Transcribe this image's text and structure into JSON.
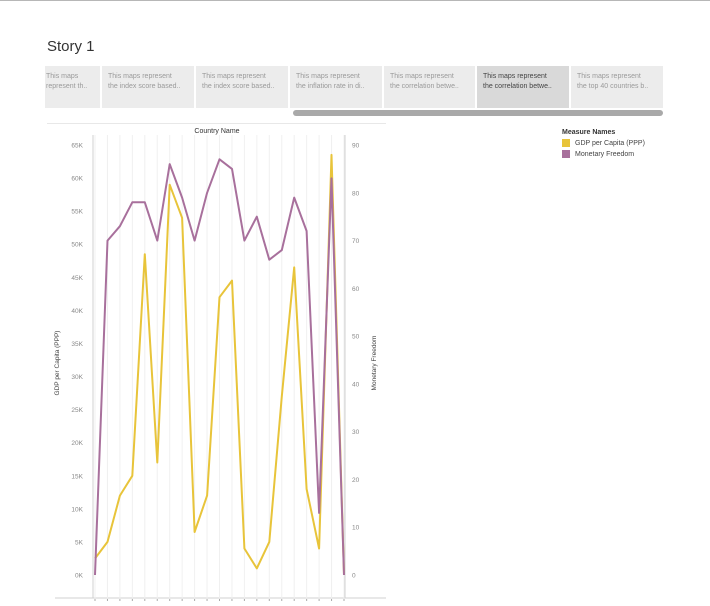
{
  "story": {
    "title": "Story 1"
  },
  "tabs": [
    {
      "line1": "This maps",
      "line2": "represent th..",
      "active": false
    },
    {
      "line1": "This maps represent",
      "line2": "the index score based..",
      "active": false
    },
    {
      "line1": "This maps represent",
      "line2": "the index score based..",
      "active": false
    },
    {
      "line1": "This maps represent",
      "line2": "the inflation rate in di..",
      "active": false
    },
    {
      "line1": "This maps represent",
      "line2": "the correlation betwe..",
      "active": false
    },
    {
      "line1": "This maps represent",
      "line2": "the correlation betwe..",
      "active": true
    },
    {
      "line1": "This maps represent",
      "line2": "the top 40 countries b..",
      "active": false
    }
  ],
  "legend": {
    "title": "Measure Names",
    "items": [
      {
        "label": "GDP per Capita (PPP)",
        "color": "#e8c43a"
      },
      {
        "label": "Monetary Freedom",
        "color": "#a8709c"
      }
    ]
  },
  "chart_data": {
    "type": "line",
    "title": "Country Name",
    "xlabel": "",
    "ylabel": "GDP per Capita (PPP)",
    "y2label": "Monetary Freedom",
    "ylim": [
      0,
      65000
    ],
    "y2lim": [
      0,
      90
    ],
    "yticks": [
      "0K",
      "5K",
      "10K",
      "15K",
      "20K",
      "25K",
      "30K",
      "35K",
      "40K",
      "45K",
      "50K",
      "55K",
      "60K",
      "65K"
    ],
    "y2ticks": [
      "0",
      "10",
      "20",
      "30",
      "40",
      "50",
      "60",
      "70",
      "80",
      "90"
    ],
    "grid": "vertical",
    "legend_position": "right",
    "x": [
      1,
      2,
      3,
      4,
      5,
      6,
      7,
      8,
      9,
      10,
      11,
      12,
      13,
      14,
      15,
      16,
      17,
      18,
      19,
      20,
      21
    ],
    "series": [
      {
        "name": "GDP per Capita (PPP)",
        "axis": "left",
        "color": "#e8c43a",
        "values": [
          2500,
          5000,
          12000,
          15000,
          48500,
          17000,
          59000,
          54000,
          6500,
          12000,
          42000,
          44500,
          4000,
          1000,
          5000,
          27000,
          46500,
          13000,
          4000,
          63500,
          0
        ]
      },
      {
        "name": "Monetary Freedom",
        "axis": "right",
        "color": "#a8709c",
        "values": [
          0,
          70,
          73,
          78,
          78,
          70,
          86,
          79,
          70,
          80,
          87,
          85,
          70,
          75,
          66,
          68,
          79,
          72,
          13,
          83,
          0
        ]
      }
    ]
  }
}
